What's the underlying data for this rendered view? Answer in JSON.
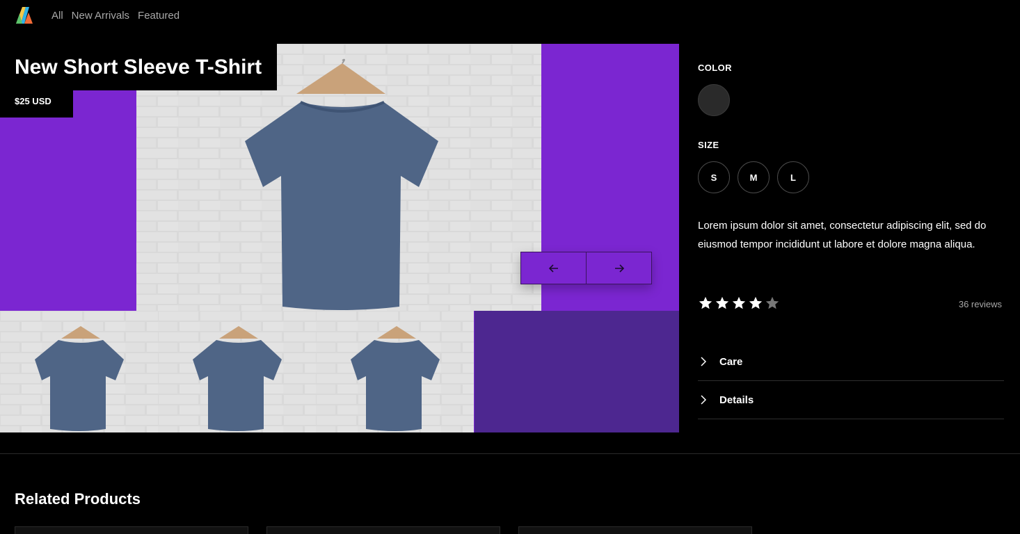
{
  "nav": {
    "logo_icon": "store-logo-icon",
    "links": [
      "All",
      "New Arrivals",
      "Featured"
    ]
  },
  "product": {
    "title": "New Short Sleeve T-Shirt",
    "price": "$25 USD",
    "image_icon": "tshirt-photo",
    "thumbnail_count": 3
  },
  "gallery": {
    "prev_icon": "arrow-left-icon",
    "next_icon": "arrow-right-icon"
  },
  "options": {
    "color_label": "COLOR",
    "colors": [
      "#2a2a2a"
    ],
    "size_label": "SIZE",
    "sizes": [
      "S",
      "M",
      "L"
    ]
  },
  "description": "Lorem ipsum dolor sit amet, consectetur adipiscing elit, sed do eiusmod tempor incididunt ut labore et dolore magna aliqua.",
  "rating": {
    "stars": 4,
    "max": 5,
    "reviews_text": "36 reviews"
  },
  "accordion": [
    {
      "label": "Care",
      "icon": "chevron-right-icon"
    },
    {
      "label": "Details",
      "icon": "chevron-right-icon"
    }
  ],
  "related": {
    "heading": "Related Products"
  },
  "colors": {
    "accent": "#7b26d1",
    "accent_dark": "#4d2790",
    "background": "#000000",
    "muted_text": "#a8a8a8"
  }
}
